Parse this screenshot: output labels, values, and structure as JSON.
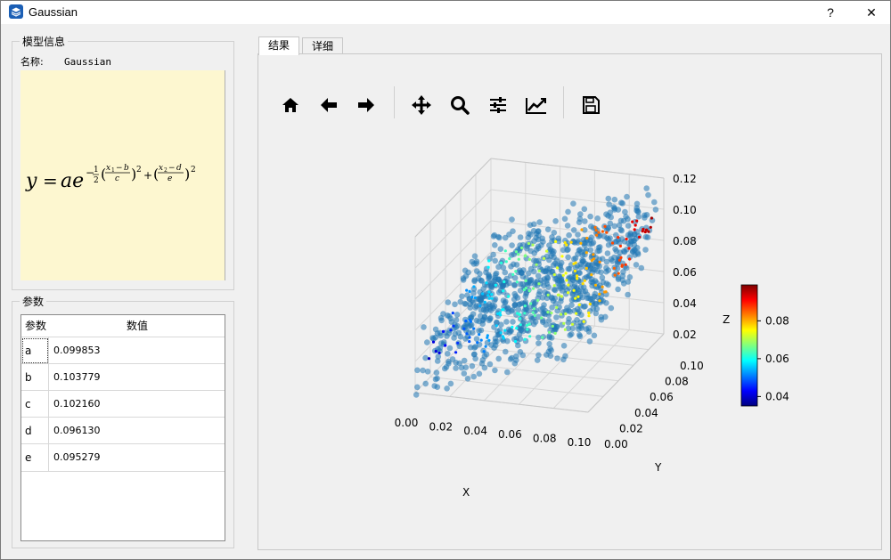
{
  "window": {
    "title": "Gaussian",
    "help_label": "?",
    "close_label": "✕"
  },
  "model_info": {
    "group_title": "模型信息",
    "name_label": "名称:",
    "name_value": "Gaussian",
    "formula_text": "y = ae^{-1/2((x1-b)/c)^2 + ((x2-d)/e)^2}"
  },
  "params": {
    "group_title": "参数",
    "headers": [
      "参数",
      "数值"
    ],
    "rows": [
      {
        "name": "a",
        "value": "0.099853"
      },
      {
        "name": "b",
        "value": "0.103779"
      },
      {
        "name": "c",
        "value": "0.102160"
      },
      {
        "name": "d",
        "value": "0.096130"
      },
      {
        "name": "e",
        "value": "0.095279"
      }
    ]
  },
  "tabs": [
    {
      "label": "结果"
    },
    {
      "label": "详细"
    }
  ],
  "toolbar": {
    "icons": [
      "home-icon",
      "back-icon",
      "forward-icon",
      "pan-icon",
      "zoom-icon",
      "configure-subplots-icon",
      "edit-axes-icon",
      "save-icon"
    ]
  },
  "chart_data": {
    "type": "scatter",
    "projection": "3d",
    "xlabel": "X",
    "ylabel": "Y",
    "zlabel": "Z",
    "x_ticks": [
      "0.00",
      "0.02",
      "0.04",
      "0.06",
      "0.08",
      "0.10"
    ],
    "y_ticks": [
      "0.00",
      "0.02",
      "0.04",
      "0.06",
      "0.08",
      "0.10"
    ],
    "z_ticks": [
      "0.02",
      "0.04",
      "0.06",
      "0.08",
      "0.10",
      "0.12"
    ],
    "xlim": [
      0,
      0.1
    ],
    "ylim": [
      0,
      0.1
    ],
    "zlim": [
      0.02,
      0.12
    ],
    "colorbar": {
      "ticks": [
        "0.04",
        "0.06",
        "0.08"
      ],
      "range": [
        0.035,
        0.099
      ],
      "colormap": "jet"
    },
    "point_color": "#1f77b4",
    "grid": true
  }
}
